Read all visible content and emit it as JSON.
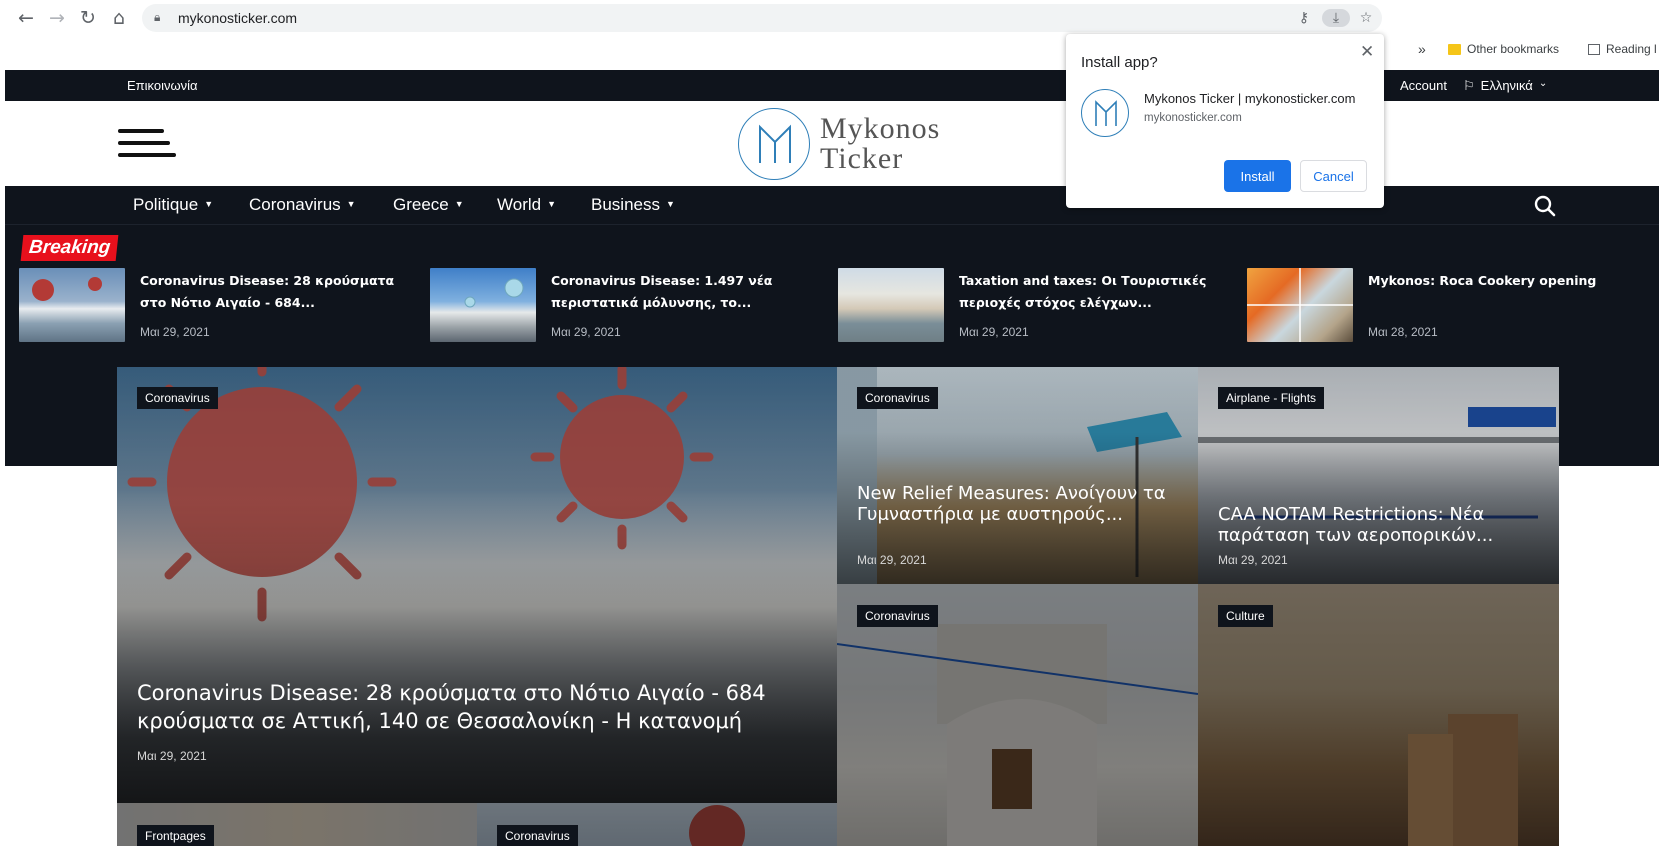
{
  "browser": {
    "url": "mykonosticker.com",
    "bookmarks": {
      "overflow": "»",
      "other": "Other bookmarks",
      "reading": "Reading l"
    }
  },
  "install_popup": {
    "title": "Install app?",
    "app_name": "Mykonos Ticker | mykonosticker.com",
    "app_domain": "mykonosticker.com",
    "install_label": "Install",
    "cancel_label": "Cancel"
  },
  "topbar": {
    "contact": "Επικοινωνία",
    "account": "Account",
    "language": "Ελληνικά"
  },
  "logo": {
    "line1": "Mykonos",
    "line2": "Ticker"
  },
  "nav": {
    "items": [
      {
        "label": "Politique"
      },
      {
        "label": "Coronavirus"
      },
      {
        "label": "Greece"
      },
      {
        "label": "World"
      },
      {
        "label": "Business"
      }
    ]
  },
  "breaking": {
    "tag": "Breaking",
    "items": [
      {
        "title": "Coronavirus Disease: 28 κρούσματα στο Νότιο Αιγαίο - 684...",
        "date": "Μαι 29, 2021"
      },
      {
        "title": "Coronavirus Disease: 1.497 νέα περιστατικά μόλυνσης, το...",
        "date": "Μαι 29, 2021"
      },
      {
        "title": "Taxation and taxes: Οι Τουριστικές περιοχές στόχος ελέγχων...",
        "date": "Μαι 29, 2021"
      },
      {
        "title": "Mykonos: Roca Cookery opening",
        "date": "Μαι 28, 2021"
      }
    ]
  },
  "featured": {
    "main": {
      "category": "Coronavirus",
      "title": "Coronavirus Disease: 28 κρούσματα στο Νότιο Αιγαίο -  684 κρούσματα σε Αττική, 140 σε Θεσσαλονίκη - Η κατανομή",
      "date": "Μαι 29, 2021"
    },
    "tile1": {
      "category": "Coronavirus",
      "title": "New Relief Measures: Ανοίγουν τα Γυμναστήρια με αυστηρούς...",
      "date": "Μαι 29, 2021"
    },
    "tile2": {
      "category": "Airplane - Flights",
      "title": "CAA NOTAM Restrictions: Νέα παράταση των αεροπορικών...",
      "date": "Μαι 29, 2021"
    },
    "tile3": {
      "category": "Coronavirus"
    },
    "tile4": {
      "category": "Culture"
    },
    "tile5": {
      "category": "Frontpages"
    },
    "tile6": {
      "category": "Coronavirus"
    }
  }
}
